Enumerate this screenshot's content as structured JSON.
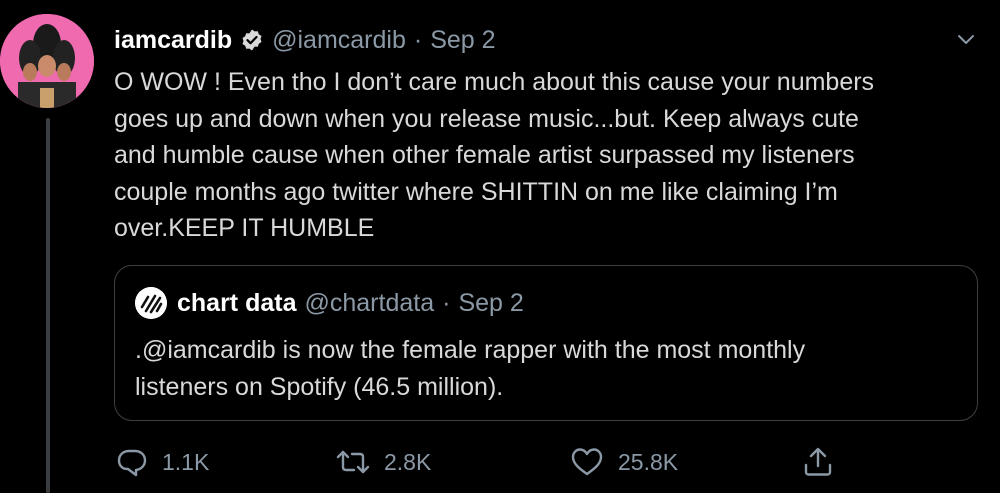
{
  "tweet": {
    "display_name": "iamcardib",
    "handle": "@iamcardib",
    "separator": "·",
    "date": "Sep 2",
    "text_lines": [
      "O WOW ! Even tho I don’t care much about this cause your numbers",
      "goes up and down when you release music...but. Keep always cute",
      "and humble cause when other female artist surpassed my listeners",
      "couple months ago twitter where SHITTIN  on me like claiming I’m",
      "over.KEEP IT HUMBLE"
    ]
  },
  "quoted_tweet": {
    "display_name": "chart data",
    "handle": "@chartdata",
    "separator": "·",
    "date": "Sep 2",
    "text_lines": [
      ".@iamcardib is now the female rapper with the most monthly",
      "listeners on Spotify (46.5 million)."
    ]
  },
  "actions": {
    "replies": "1.1K",
    "retweets": "2.8K",
    "likes": "25.8K"
  },
  "icons": {
    "verified": "verified-badge-icon",
    "caret": "chevron-down-icon",
    "reply": "reply-icon",
    "retweet": "retweet-icon",
    "like": "heart-icon",
    "share": "share-icon"
  },
  "colors": {
    "background": "#000000",
    "text": "#d9d9d9",
    "secondary": "#8b98a5",
    "avatar_bg": "#f06ab0"
  }
}
